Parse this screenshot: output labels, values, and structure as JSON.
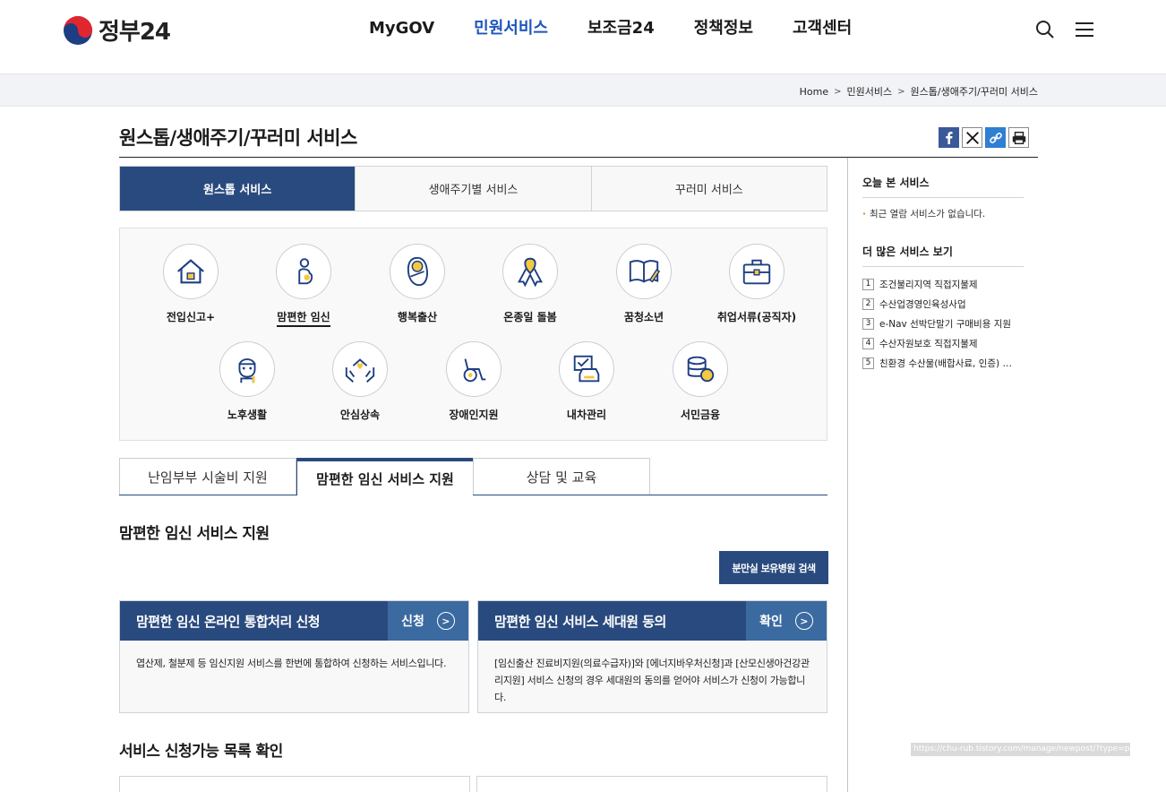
{
  "header": {
    "logo_text": "정부24",
    "nav": [
      "MyGOV",
      "민원서비스",
      "보조금24",
      "정책정보",
      "고객센터"
    ],
    "active_nav": 1
  },
  "breadcrumb": [
    "Home",
    "민원서비스",
    "원스톱/생애주기/꾸러미 서비스"
  ],
  "page_title": "원스톱/생애주기/꾸러미 서비스",
  "main_tabs": [
    "원스톱 서비스",
    "생애주기별 서비스",
    "꾸러미 서비스"
  ],
  "services": [
    {
      "label": "전입신고+",
      "icon": "house-icon"
    },
    {
      "label": "맘편한 임신",
      "icon": "pregnant-icon"
    },
    {
      "label": "행복출산",
      "icon": "baby-icon"
    },
    {
      "label": "온종일 돌봄",
      "icon": "ribbon-icon"
    },
    {
      "label": "꿈청소년",
      "icon": "book-icon"
    },
    {
      "label": "취업서류(공직자)",
      "icon": "briefcase-icon"
    },
    {
      "label": "노후생활",
      "icon": "elder-icon"
    },
    {
      "label": "안심상속",
      "icon": "hands-house-icon"
    },
    {
      "label": "장애인지원",
      "icon": "wheelchair-icon"
    },
    {
      "label": "내차관리",
      "icon": "car-icon"
    },
    {
      "label": "서민금융",
      "icon": "coins-icon"
    }
  ],
  "sub_tabs": [
    "난임부부 시술비 지원",
    "맘편한 임신 서비스 지원",
    "상담 및 교육"
  ],
  "section_title": "맘편한 임신 서비스 지원",
  "search_button": "분만실 보유병원 검색",
  "cards": [
    {
      "title": "맘편한 임신 온라인 통합처리 신청",
      "action": "신청",
      "desc": "엽산제, 철분제 등 임신지원 서비스를 한번에 통합하여 신청하는 서비스입니다."
    },
    {
      "title": "맘편한 임신 서비스 세대원 동의",
      "action": "확인",
      "desc": "[임신출산 진료비지원(의료수급자)]와 [에너지바우처신청]과 [산모신생아건강관리지원] 서비스 신청의 경우 세대원의 동의를 얻어야 서비스가 신청이 가능합니다."
    }
  ],
  "section2_title": "서비스 신청가능 목록 확인",
  "aside": {
    "recent_title": "오늘 본 서비스",
    "recent_empty": "최근 열람 서비스가 없습니다.",
    "more_title": "더 많은 서비스 보기",
    "more_items": [
      "조건불리지역 직접지불제",
      "수산업경영인육성사업",
      "e-Nav 선박단말기 구매비용 지원",
      "수산자원보호 직접지불제",
      "친환경 수산물(배합사료, 인증) …"
    ]
  },
  "url_tooltip": "https://chu-rub.tistory.com/manage/newpost/?type=p"
}
